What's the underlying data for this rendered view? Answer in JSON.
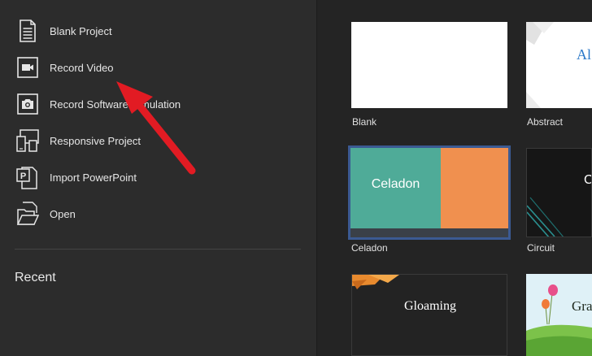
{
  "menu": {
    "blank_project": "Blank Project",
    "record_video": "Record Video",
    "record_software_simulation": "Record Software Simulation",
    "responsive_project": "Responsive Project",
    "import_powerpoint": "Import PowerPoint",
    "open": "Open"
  },
  "recent": {
    "heading": "Recent"
  },
  "templates": {
    "blank": {
      "caption": "Blank"
    },
    "abstract": {
      "caption": "Abstract",
      "thumb_text": "Al"
    },
    "celadon": {
      "caption": "Celadon",
      "thumb_text": "Celadon"
    },
    "circuit": {
      "caption": "Circuit",
      "thumb_text": "C"
    },
    "gloaming": {
      "thumb_text": "Gloaming"
    },
    "grass": {
      "thumb_text": "Gra"
    }
  },
  "colors": {
    "annotation_arrow": "#e21b23",
    "celadon_teal": "#4fab98",
    "celadon_orange": "#f0904f",
    "selection_border": "#3b5a93",
    "abstract_text": "#2a78c8"
  },
  "icons": {
    "blank_project": "document-lines-icon",
    "record_video": "video-camera-icon",
    "record_software_simulation": "photo-camera-icon",
    "responsive_project": "responsive-devices-icon",
    "import_powerpoint": "powerpoint-icon",
    "open": "folder-open-icon"
  }
}
